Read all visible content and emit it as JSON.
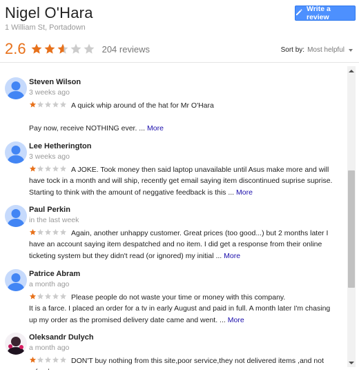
{
  "header": {
    "title": "Nigel O'Hara",
    "address": "1 William St, Portadown",
    "write_review": "Write a review"
  },
  "summary": {
    "rating": "2.6",
    "rating_value": 2.6,
    "count": "204 reviews"
  },
  "sort": {
    "label": "Sort by:",
    "value": "Most helpful"
  },
  "colors": {
    "accent": "#4d90fe",
    "star": "#e7711b",
    "star_empty": "#cccccc",
    "link": "#1a0dab"
  },
  "reviews": [
    {
      "name": "Steven Wilson",
      "time": "3 weeks ago",
      "rating": 1,
      "text": "A quick whip around of the hat for Mr O'Hara\n\nPay now, receive NOTHING ever. ...",
      "more": "More"
    },
    {
      "name": "Lee Hetherington",
      "time": "3 weeks ago",
      "rating": 1,
      "text": "A JOKE. Took money then said laptop unavailable until Asus make more and will have tock in a month and will ship, recently get email saying item discontinued suprise suprise. Starting to think with the amount of neggative feedback is this ...",
      "more": "More"
    },
    {
      "name": "Paul Perkin",
      "time": "in the last week",
      "rating": 1,
      "text": "Again, another unhappy customer.  Great prices (too good...) but 2 months later I have an account saying item despatched and no item.  I did get a response from their online ticketing system but they didn't read (or ignored) my initial ...",
      "more": "More"
    },
    {
      "name": "Patrice Abram",
      "time": "a month ago",
      "rating": 1,
      "text": "Please people do not waste your time or money with this company.\nIt is a farce. I placed an order for a tv in early August and paid in full. A month later I'm chasing up my order as the promised delivery date came and went. ...",
      "more": "More"
    },
    {
      "name": "Oleksandr Dulych",
      "time": "a month ago",
      "rating": 1,
      "text": "DON'T buy nothing from this site,poor service,they not delivered items ,and not refund",
      "more": ""
    }
  ]
}
